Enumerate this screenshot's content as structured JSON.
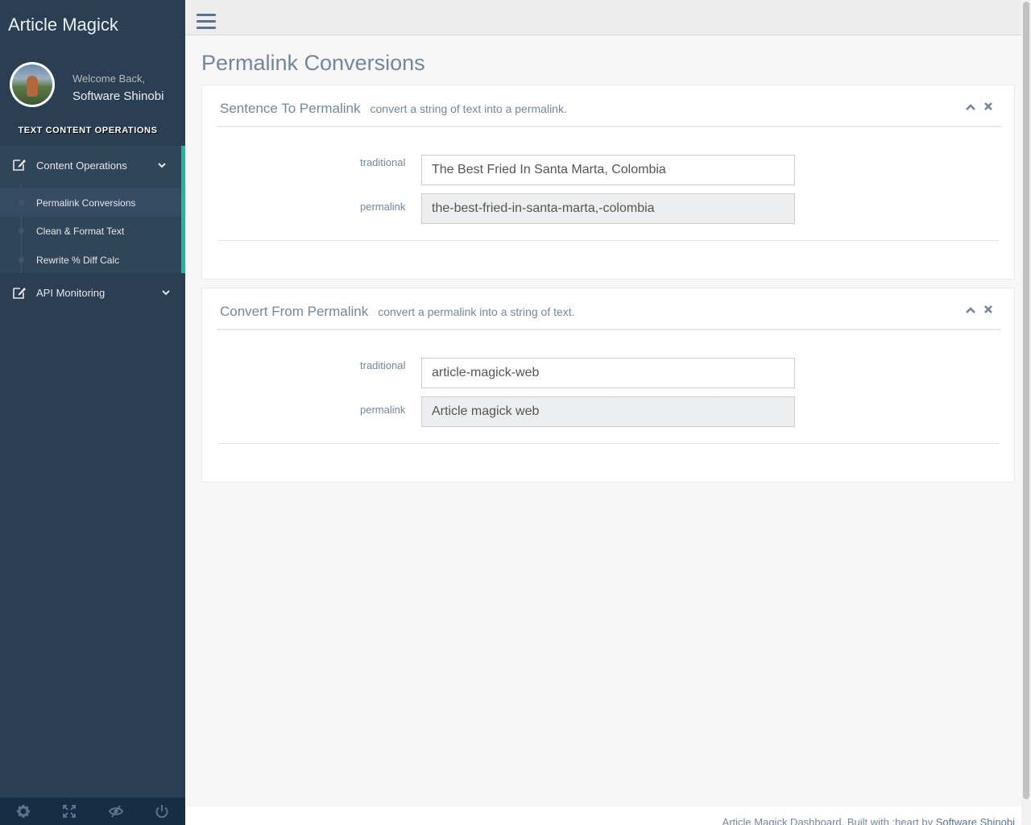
{
  "app": {
    "title": "Article Magick"
  },
  "profile": {
    "welcome": "Welcome Back,",
    "name": "Software Shinobi"
  },
  "sidebar": {
    "section_title": "TEXT CONTENT OPERATIONS",
    "menu": {
      "content_operations": {
        "label": "Content Operations",
        "icon": "edit-icon",
        "children": [
          {
            "label": "Permalink Conversions",
            "active": true
          },
          {
            "label": "Clean & Format Text"
          },
          {
            "label": "Rewrite % Diff Calc"
          }
        ]
      },
      "api_monitoring": {
        "label": "API Monitoring",
        "icon": "edit-icon"
      }
    },
    "footer_icons": [
      "gear-icon",
      "fullscreen-icon",
      "eye-slash-icon",
      "power-icon"
    ]
  },
  "page": {
    "title": "Permalink Conversions"
  },
  "panels": [
    {
      "title": "Sentence To Permalink",
      "subtitle": "convert a string of text into a permalink.",
      "traditional_label": "traditional",
      "traditional_value": "The Best Fried In Santa Marta, Colombia",
      "permalink_label": "permalink",
      "permalink_value": "the-best-fried-in-santa-marta,-colombia"
    },
    {
      "title": "Convert From Permalink",
      "subtitle": "convert a permalink into a string of text.",
      "traditional_label": "traditional",
      "traditional_value": "article-magick-web",
      "permalink_label": "permalink",
      "permalink_value": "Article magick web"
    }
  ],
  "footer": {
    "text": "Article Magick Dashboard. Built with :heart by",
    "link": "Software Shinobi"
  },
  "colors": {
    "sidebar": "#2a3f54",
    "accent": "#1abb9c",
    "text": "#73879c"
  }
}
